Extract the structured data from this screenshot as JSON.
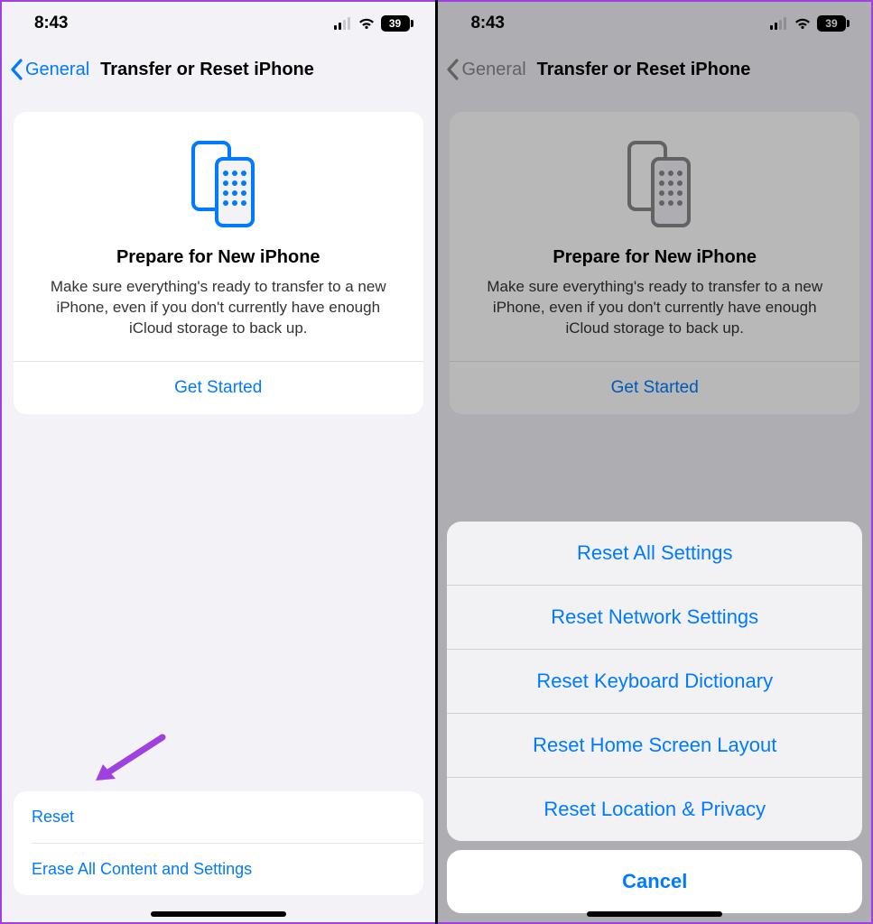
{
  "status": {
    "time": "8:43",
    "battery": "39"
  },
  "nav": {
    "back": "General",
    "title": "Transfer or Reset iPhone"
  },
  "prepare": {
    "title": "Prepare for New iPhone",
    "desc": "Make sure everything's ready to transfer to a new iPhone, even if you don't currently have enough iCloud storage to back up.",
    "cta": "Get Started"
  },
  "bottom": {
    "reset": "Reset",
    "erase": "Erase All Content and Settings"
  },
  "sheet": {
    "items": {
      "all": "Reset All Settings",
      "network": "Reset Network Settings",
      "keyboard": "Reset Keyboard Dictionary",
      "home": "Reset Home Screen Layout",
      "location": "Reset Location & Privacy"
    },
    "cancel": "Cancel"
  },
  "annotation": {
    "highlight_color": "#a040e0"
  }
}
